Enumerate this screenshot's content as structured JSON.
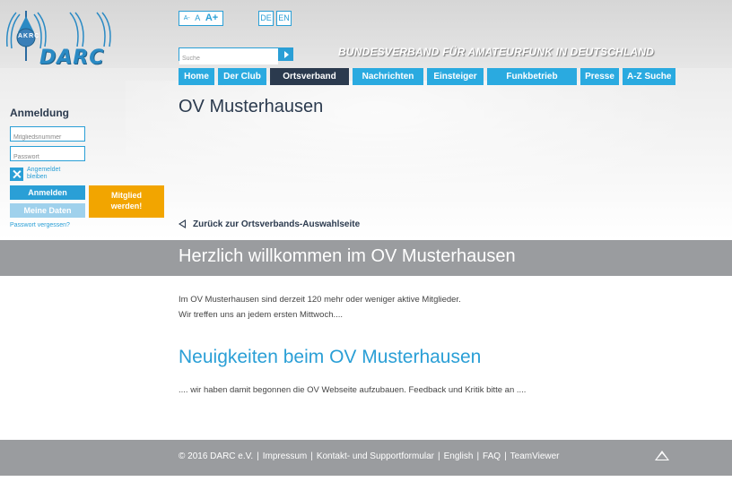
{
  "header": {
    "logo_text": "DARC",
    "logo_ring_text": "AKRC",
    "tagline": "BUNDESVERBAND FÜR AMATEURFUNK IN DEUTSCHLAND",
    "font_controls": {
      "small": "A-",
      "medium": "A",
      "large": "A+"
    },
    "languages": [
      "DE",
      "EN"
    ],
    "search_placeholder": "Suche"
  },
  "nav": {
    "items": [
      {
        "label": "Home",
        "active": false
      },
      {
        "label": "Der Club",
        "active": false
      },
      {
        "label": "Ortsverband",
        "active": true
      },
      {
        "label": "Nachrichten",
        "active": false
      },
      {
        "label": "Einsteiger",
        "active": false
      },
      {
        "label": "Funkbetrieb",
        "active": false
      },
      {
        "label": "Presse",
        "active": false
      },
      {
        "label": "A-Z Suche",
        "active": false
      }
    ]
  },
  "sidebar": {
    "title": "Anmeldung",
    "member_placeholder": "Mitgliedsnummer",
    "password_placeholder": "Passwort",
    "remember_label": "Angemeldet bleiben",
    "login_button": "Anmelden",
    "my_data_button": "Meine Daten",
    "become_member_button": "Mitglied werden!",
    "forgot_link": "Passwort vergessen?"
  },
  "main": {
    "page_title": "OV Musterhausen",
    "back_link": "Zurück zur Ortsverbands-Auswahlseite",
    "welcome_title": "Herzlich willkommen im OV Musterhausen",
    "intro_line_1": "Im OV Musterhausen sind derzeit 120 mehr oder weniger aktive Mitglieder.",
    "intro_line_2": "Wir treffen uns an jedem ersten Mittwoch....",
    "news_title": "Neuigkeiten beim OV Musterhausen",
    "news_text": ".... wir haben damit begonnen die OV Webseite aufzubauen. Feedback und Kritik bitte an ...."
  },
  "footer": {
    "copyright": "© 2016 DARC e.V.",
    "links": [
      "Impressum",
      "Kontakt- und Supportformular",
      "English",
      "FAQ",
      "TeamViewer"
    ],
    "separator": "|"
  },
  "colors": {
    "accent": "#2a9fd6",
    "nav_blue": "#2aaae0",
    "nav_active": "#2b3a4e",
    "member_orange": "#f2a500",
    "band_gray": "#9a9c9f"
  }
}
